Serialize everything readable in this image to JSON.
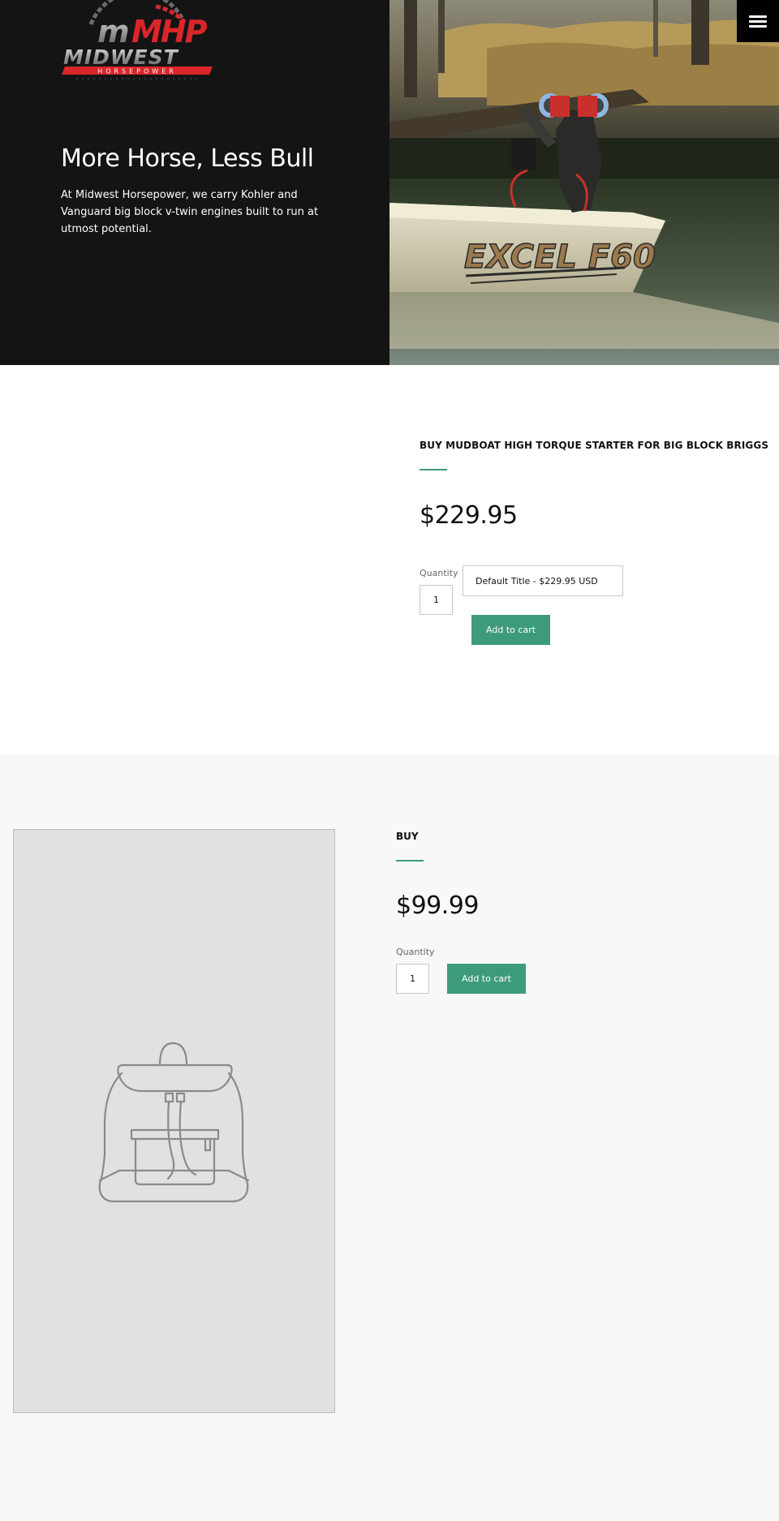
{
  "hero": {
    "logo_text": "MHP",
    "logo_name": "MIDWEST",
    "logo_sub": "HORSEPOWER",
    "title": "More Horse, Less Bull",
    "description": "At Midwest Horsepower, we carry Kohler and Vanguard big block v-twin engines built to run at utmost potential.",
    "boat_text": "EXCEL F60",
    "menu_icon": "hamburger-menu-icon"
  },
  "product1": {
    "title": "BUY MUDBOAT HIGH TORQUE STARTER FOR BIG BLOCK BRIGGS",
    "price": "$229.95",
    "quantity_label": "Quantity",
    "quantity_value": "1",
    "variant": "Default Title - $229.95 USD",
    "add_to_cart": "Add to cart"
  },
  "product2": {
    "title": "BUY",
    "price": "$99.99",
    "quantity_label": "Quantity",
    "quantity_value": "1",
    "add_to_cart": "Add to cart",
    "image_icon": "backpack-placeholder-icon"
  },
  "colors": {
    "hero_bg": "#141414",
    "accent": "#3d9b7b",
    "logo_red": "#d9262a",
    "section_gray": "#f8f8f8"
  }
}
